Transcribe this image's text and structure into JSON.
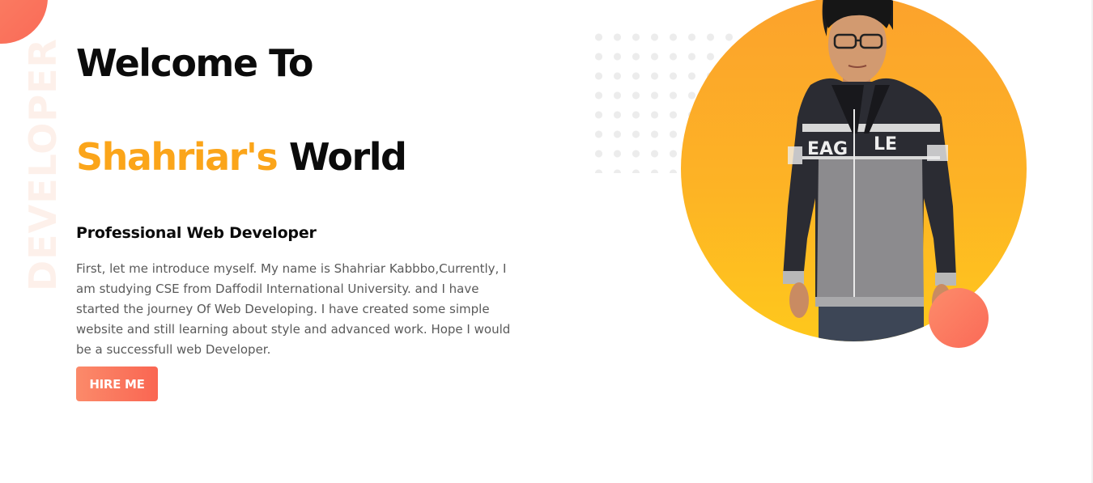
{
  "decor": {
    "vertical_word": "DEVELOPER"
  },
  "hero": {
    "title": "Welcome To",
    "name_accent": "Shahriar's",
    "name_rest": "World",
    "role": "Professional Web Developer",
    "bio": "First, let me introduce myself. My name is Shahriar Kabbbo,Currently, I am studying CSE from Daffodil International University. and I have started the journey Of Web Developing. I have created some simple website and still learning about style and advanced work. Hope I would be a successfull web Developer.",
    "hire_button": "HIRE ME"
  },
  "portrait": {
    "shirt_print_left": "EAG",
    "shirt_print_right": "LE"
  },
  "colors": {
    "accent_orange": "#fba51a",
    "button_coral": "#fa6a57",
    "circle_orange": "#fdb325"
  }
}
